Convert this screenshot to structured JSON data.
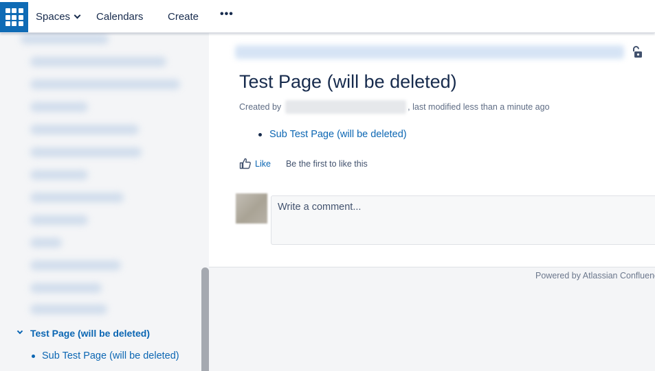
{
  "topbar": {
    "spaces_label": "Spaces",
    "calendars_label": "Calendars",
    "create_label": "Create",
    "more_label": "•••",
    "accent_color": "#0f6bb5"
  },
  "sidebar": {
    "active_page": "Test Page (will be deleted)",
    "child_page": "Sub Test Page (will be deleted)"
  },
  "page": {
    "title": "Test Page (will be deleted)",
    "created_by_label": "Created by",
    "modified_text": ", last modified less than a minute ago",
    "children": [
      "Sub Test Page (will be deleted)"
    ],
    "like_label": "Like",
    "like_status": "Be the first to like this",
    "comment_placeholder": "Write a comment..."
  },
  "footer": {
    "powered_by": "Powered by Atlassian Confluence"
  }
}
